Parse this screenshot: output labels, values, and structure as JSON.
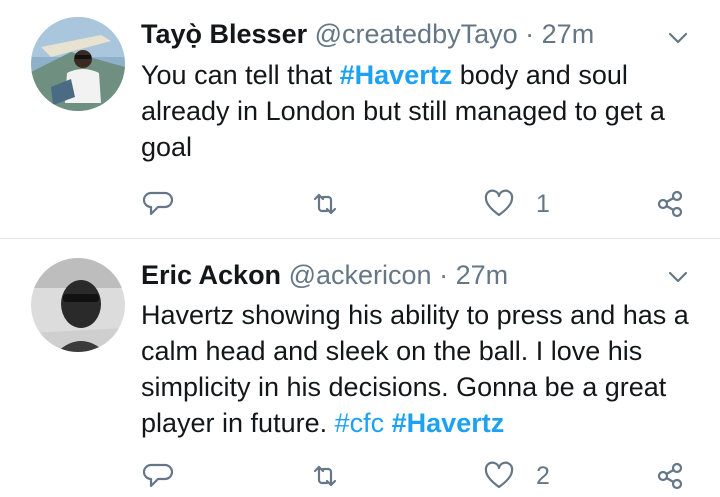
{
  "tweets": [
    {
      "display_name": "Tayọ̀ Blesser",
      "handle": "@createdbyTayo",
      "separator": "·",
      "time": "27m",
      "text_parts": [
        {
          "text": "You can tell that ",
          "kind": "text"
        },
        {
          "text": "#Havertz",
          "kind": "hashtag-bold"
        },
        {
          "text": " body and soul already in London but still managed to get a goal",
          "kind": "text"
        }
      ],
      "like_count": "1"
    },
    {
      "display_name": "Eric Ackon",
      "handle": "@ackericon",
      "separator": "·",
      "time": "27m",
      "text_parts": [
        {
          "text": "Havertz showing his ability to press and has a calm head and sleek on the ball. I love his simplicity in his decisions. Gonna be a great player in future. ",
          "kind": "text"
        },
        {
          "text": "#cfc",
          "kind": "hashtag"
        },
        {
          "text": " ",
          "kind": "text"
        },
        {
          "text": "#Havertz",
          "kind": "hashtag-bold"
        }
      ],
      "like_count": "2"
    }
  ],
  "icons": {
    "reply": "reply-icon",
    "retweet": "retweet-icon",
    "like": "heart-icon",
    "share": "share-icon",
    "menu": "chevron-down-icon"
  },
  "colors": {
    "link": "#1da1f2",
    "meta": "#657786",
    "divider": "#e1e8ed"
  }
}
